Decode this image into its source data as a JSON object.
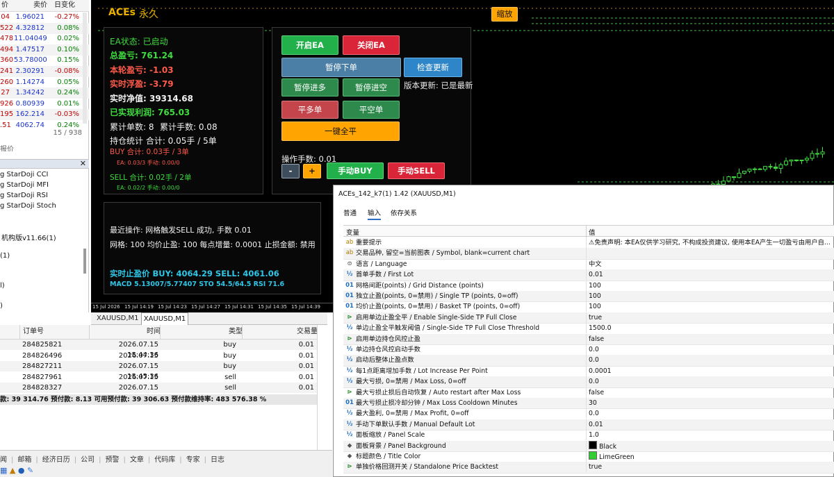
{
  "market_watch": {
    "headers": [
      "价",
      "卖价",
      "日变化"
    ],
    "rows": [
      {
        "bid": "04",
        "ask": "1.96021",
        "change": "-0.27%",
        "dir": "neg"
      },
      {
        "bid": "522",
        "ask": "4.32812",
        "change": "0.08%",
        "dir": "pos"
      },
      {
        "bid": "478",
        "ask": "11.04049",
        "change": "0.02%",
        "dir": "pos"
      },
      {
        "bid": "494",
        "ask": "1.47517",
        "change": "0.10%",
        "dir": "pos"
      },
      {
        "bid": "360",
        "ask": "53.78000",
        "change": "0.15%",
        "dir": "pos"
      },
      {
        "bid": "241",
        "ask": "2.30291",
        "change": "-0.08%",
        "dir": "neg"
      },
      {
        "bid": "260",
        "ask": "1.14274",
        "change": "0.05%",
        "dir": "pos"
      },
      {
        "bid": "27",
        "ask": "1.34242",
        "change": "0.24%",
        "dir": "pos"
      },
      {
        "bid": "926",
        "ask": "0.80939",
        "change": "0.01%",
        "dir": "pos"
      },
      {
        "bid": "195",
        "ask": "162.214",
        "change": "-0.03%",
        "dir": "neg"
      },
      {
        "bid": ".51",
        "ask": "4062.74",
        "change": "0.24%",
        "dir": "pos"
      }
    ],
    "count": "15 / 938",
    "footer": "报价"
  },
  "navigator": {
    "items": [
      "g StarDoji CCI",
      "g StarDoji MFI",
      "g StarDoji RSI",
      "g StarDoji Stoch",
      "机构版v11.66(1)",
      "(1)",
      "l)",
      ")"
    ]
  },
  "panel": {
    "title": "ACEs",
    "license": "永久",
    "collapse_btn": "缩放",
    "stats": {
      "ea_status": "EA状态: 已启动",
      "total_profit": "总盈亏: 761.24",
      "round_profit": "本轮盈亏: -1.03",
      "floating": "实时浮盈: -3.79",
      "equity": "实时净值: 39314.68",
      "realized": "已实现利润: 765.03",
      "cum_count": "累计单数: 8",
      "cum_lots": "累计手数: 0.08",
      "pos_stats": "持仓统计 合计: 0.05手 / 5单",
      "buy_total": "BUY 合计: 0.03手 / 3单",
      "buy_detail": "EA: 0.03/3  手动: 0.00/0",
      "sell_total": "SELL 合计: 0.02手 / 2单",
      "sell_detail": "EA: 0.02/2  手动: 0.00/0"
    },
    "buttons": {
      "start_ea": "开启EA",
      "stop_ea": "关闭EA",
      "pause_order": "暂停下单",
      "check_update": "检查更新",
      "pause_add": "暂停进多",
      "pause_short": "暂停进空",
      "version": "版本更新: 已是最新",
      "close_long": "平多单",
      "close_short": "平空单",
      "close_all": "一键全平",
      "lot_label": "操作手数: 0.01",
      "minus": "-",
      "plus": "+",
      "manual_buy": "手动BUY",
      "manual_sell": "手动SELL"
    },
    "log": {
      "last_action": "最近操作: 网格触发SELL 成功, 手数 0.01",
      "grid_line": "网格: 100  均价止盈: 100  每点增量: 0.0001  止损金额: 禁用",
      "tp_price": "实时止盈价 BUY: 4064.29  SELL: 4061.06",
      "indicators": "MACD 5.13007/5.77407  STO 54.5/64.5  RSI 71.6"
    },
    "colors": {
      "accent": "#ffa400",
      "title": "#e9b200"
    }
  },
  "chart": {
    "time_axis": [
      "15 Jul 2026",
      "15 Jul 14:19",
      "15 Jul 14:23",
      "15 Jul 14:27",
      "15 Jul 14:31",
      "15 Jul 14:35",
      "15 Jul 14:39"
    ],
    "tabs": [
      "XAUUSD,M1",
      "XAUUSD,M1"
    ],
    "active_tab": 1
  },
  "trade_table": {
    "headers": [
      "订单号",
      "时间",
      "类型",
      "交易量"
    ],
    "rows": [
      {
        "order": "284825821",
        "time": "2026.07.15 15:44:36",
        "type": "buy",
        "volume": "0.01"
      },
      {
        "order": "284826496",
        "time": "2026.07.15 15:45:02",
        "type": "buy",
        "volume": "0.01"
      },
      {
        "order": "284827211",
        "time": "2026.07.15 15:45:36",
        "type": "buy",
        "volume": "0.01"
      },
      {
        "order": "284827961",
        "time": "2026.07.15 15:46:55",
        "type": "sell",
        "volume": "0.01"
      },
      {
        "order": "284828327",
        "time": "2026.07.15 15:47:28",
        "type": "sell",
        "volume": "0.01"
      }
    ],
    "summary": "款: 39 314.76  预付款: 8.13  可用预付款: 39 306.63  预付款维持率: 483 576.38 %"
  },
  "bottom_tabs": [
    "闻",
    "邮箱",
    "经济日历",
    "公司",
    "预警",
    "文章",
    "代码库",
    "专家",
    "日志"
  ],
  "dialog": {
    "title": "ACEs_142_k7(1) 1.42 (XAUUSD,M1)",
    "tabs": [
      "普通",
      "输入",
      "依存关系"
    ],
    "active_tab": 1,
    "col_variable": "变量",
    "col_value": "值",
    "params": [
      {
        "icon": "ab",
        "kind": "str",
        "name": "重要提示",
        "value": "⚠免责声明: 本EA仅供学习研究, 不构成投资建议, 使用本EA产生一切盈亏由用户自..."
      },
      {
        "icon": "ab",
        "kind": "str",
        "name": "交易品种, 留空=当前图表 / Symbol, blank=current chart",
        "value": ""
      },
      {
        "icon": "⊜",
        "kind": "enum",
        "name": "语言 / Language",
        "value": "中文"
      },
      {
        "icon": "½",
        "kind": "num",
        "name": "首单手数 / First Lot",
        "value": "0.01"
      },
      {
        "icon": "01",
        "kind": "num",
        "name": "网格间距(points) / Grid Distance (points)",
        "value": "100"
      },
      {
        "icon": "01",
        "kind": "num",
        "name": "独立止盈(points, 0=禁用) / Single TP (points, 0=off)",
        "value": "100"
      },
      {
        "icon": "01",
        "kind": "num",
        "name": "均价止盈(points, 0=禁用) / Basket TP (points, 0=off)",
        "value": "100"
      },
      {
        "icon": "⊳",
        "kind": "bool",
        "name": "启用单边止盈全平 / Enable Single-Side TP Full Close",
        "value": "true"
      },
      {
        "icon": "½",
        "kind": "num",
        "name": "单边止盈全平触发阈值 / Single-Side TP Full Close Threshold",
        "value": "1500.0"
      },
      {
        "icon": "⊳",
        "kind": "bool",
        "name": "启用单边持仓风控止盈",
        "value": "false"
      },
      {
        "icon": "½",
        "kind": "num",
        "name": "单边持仓风控启动手数",
        "value": "0.0"
      },
      {
        "icon": "½",
        "kind": "num",
        "name": "启动后整体止盈点数",
        "value": "0.0"
      },
      {
        "icon": "½",
        "kind": "num",
        "name": "每1点距离增加手数 / Lot Increase Per Point",
        "value": "0.0001"
      },
      {
        "icon": "½",
        "kind": "num",
        "name": "最大亏损, 0=禁用 / Max Loss, 0=off",
        "value": "0.0"
      },
      {
        "icon": "⊳",
        "kind": "bool",
        "name": "最大亏损止损后自动恢复 / Auto restart after Max Loss",
        "value": "false"
      },
      {
        "icon": "01",
        "kind": "num",
        "name": "最大亏损止损冷却分钟 / Max Loss Cooldown Minutes",
        "value": "30"
      },
      {
        "icon": "½",
        "kind": "num",
        "name": "最大盈利, 0=禁用 / Max Profit, 0=off",
        "value": "0.0"
      },
      {
        "icon": "½",
        "kind": "num",
        "name": "手动下单默认手数 / Manual Default Lot",
        "value": "0.01"
      },
      {
        "icon": "½",
        "kind": "num",
        "name": "面板缩放 / Panel Scale",
        "value": "1.0"
      },
      {
        "icon": "◆",
        "kind": "enum",
        "name": "面板背景 / Panel Background",
        "value": "Black",
        "swatch": "#000000"
      },
      {
        "icon": "◆",
        "kind": "enum",
        "name": "标题颜色 / Title Color",
        "value": "LimeGreen",
        "swatch": "#32cd32"
      },
      {
        "icon": "⊳",
        "kind": "bool",
        "name": "单独价格回测开关 / Standalone Price Backtest",
        "value": "true"
      }
    ]
  }
}
